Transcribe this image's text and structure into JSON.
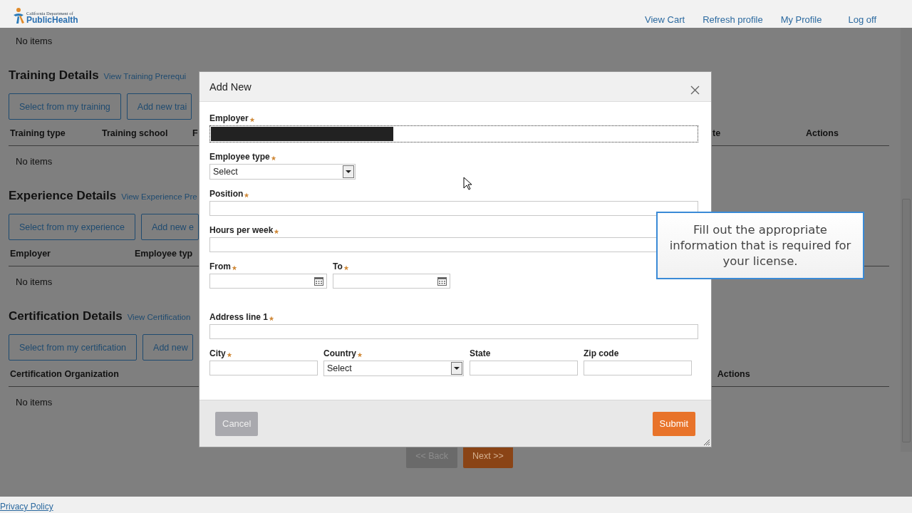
{
  "header": {
    "logo": {
      "line_1": "California Department of",
      "line_2": "PublicHealth"
    },
    "nav": [
      "View Cart",
      "Refresh profile",
      "My Profile",
      "Log off"
    ]
  },
  "page": {
    "top_empty": "No items",
    "sections": [
      {
        "kind": "training",
        "title": "Training Details",
        "link": "View Training Prerequi",
        "buttons": [
          "Select from my training",
          "Add new trai"
        ],
        "columns": [
          "Training type",
          "Training school",
          "F",
          "te",
          "Actions"
        ],
        "empty": "No items"
      },
      {
        "kind": "experience",
        "title": "Experience Details",
        "link": "View Experience Pre",
        "buttons": [
          "Select from my experience",
          "Add new e"
        ],
        "columns": [
          "Employer",
          "Employee typ"
        ],
        "empty": "No items"
      },
      {
        "kind": "certification",
        "title": "Certification Details",
        "link": "View Certification",
        "buttons": [
          "Select from my certification",
          "Add new"
        ],
        "columns": [
          "Certification Organization",
          "Actions"
        ],
        "empty": "No items"
      }
    ],
    "nav_buttons": [
      {
        "label": "<< Back",
        "disabled": true
      },
      {
        "label": "Next >>",
        "disabled": false
      }
    ]
  },
  "footer": {
    "link": "Privacy Policy"
  },
  "dialog": {
    "title": "Add New",
    "rows": [
      [
        {
          "label": "Employer",
          "required": true,
          "kind": "text",
          "redacted": true,
          "focused": true
        }
      ],
      [
        {
          "label": "Employee type",
          "required": true,
          "kind": "select",
          "value": "Select"
        }
      ],
      [
        {
          "label": "Position",
          "required": true,
          "kind": "text"
        }
      ],
      [
        {
          "label": "Hours per week",
          "required": true,
          "kind": "text"
        }
      ],
      [
        {
          "label": "From",
          "required": true,
          "kind": "date"
        },
        {
          "label": "To",
          "required": true,
          "kind": "date"
        }
      ],
      [
        {
          "label": "Address line 1",
          "required": true,
          "kind": "text"
        }
      ],
      [
        {
          "label": "City",
          "required": true,
          "kind": "text"
        },
        {
          "label": "Country",
          "required": true,
          "kind": "select",
          "value": "Select"
        },
        {
          "label": "State",
          "required": false,
          "kind": "text"
        },
        {
          "label": "Zip code",
          "required": false,
          "kind": "text"
        }
      ]
    ],
    "buttons": [
      {
        "label": "Cancel",
        "kind": "secondary"
      },
      {
        "label": "Submit",
        "kind": "primary"
      }
    ]
  },
  "tooltip": {
    "text": "Fill out the appropriate information that is required for your license."
  }
}
